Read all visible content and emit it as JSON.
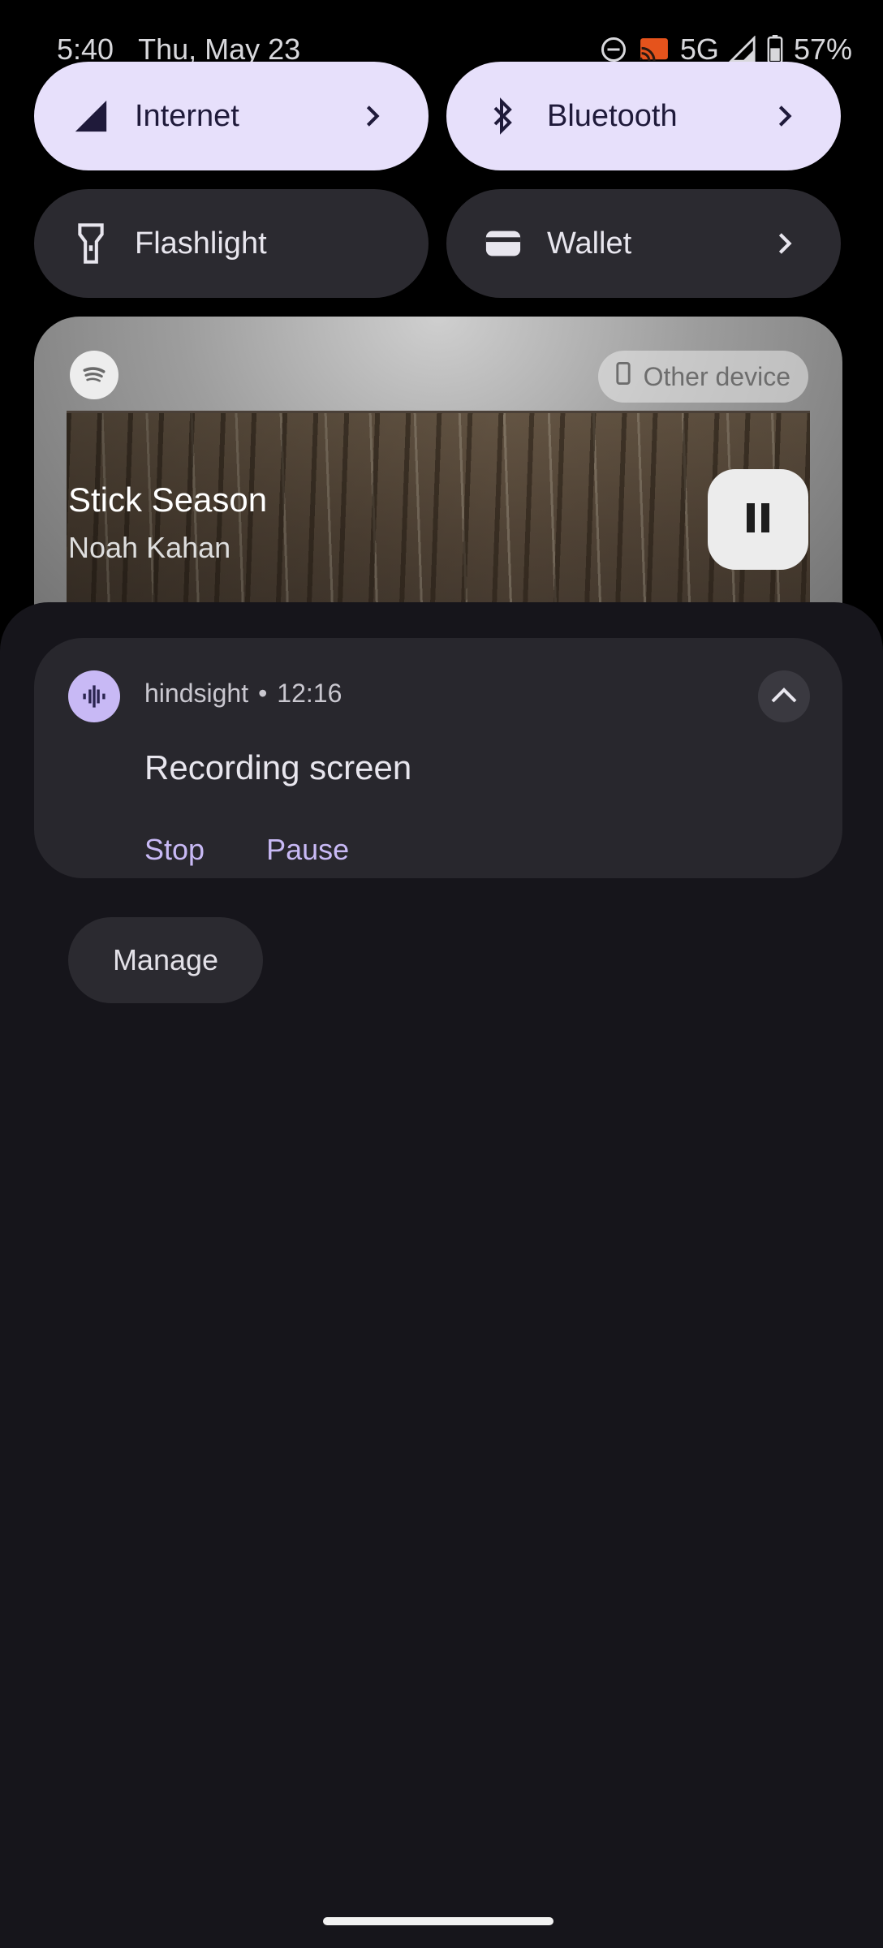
{
  "status_bar": {
    "time": "5:40",
    "date": "Thu, May 23",
    "network": "5G",
    "battery": "57%",
    "icons": [
      "do-not-disturb-icon",
      "cast-icon",
      "signal-icon",
      "battery-icon"
    ]
  },
  "quick_tiles": [
    {
      "label": "Internet",
      "icon": "signal-icon",
      "state": "on",
      "has_chevron": true
    },
    {
      "label": "Bluetooth",
      "icon": "bluetooth-icon",
      "state": "on",
      "has_chevron": true
    },
    {
      "label": "Flashlight",
      "icon": "flashlight-icon",
      "state": "off",
      "has_chevron": false
    },
    {
      "label": "Wallet",
      "icon": "wallet-icon",
      "state": "off",
      "has_chevron": true
    }
  ],
  "media": {
    "app_icon": "spotify-icon",
    "output_chip": "Other device",
    "title": "Stick Season",
    "artist": "Noah Kahan",
    "control": "pause-icon"
  },
  "notification": {
    "app": "hindsight",
    "separator": "•",
    "time": "12:16",
    "title": "Recording screen",
    "actions": [
      "Stop",
      "Pause"
    ]
  },
  "manage_label": "Manage",
  "colors": {
    "tile_on": "#e7e0fb",
    "tile_off": "#2b2a30",
    "panel_bg": "#16151b",
    "accent": "#c8b9f5"
  }
}
